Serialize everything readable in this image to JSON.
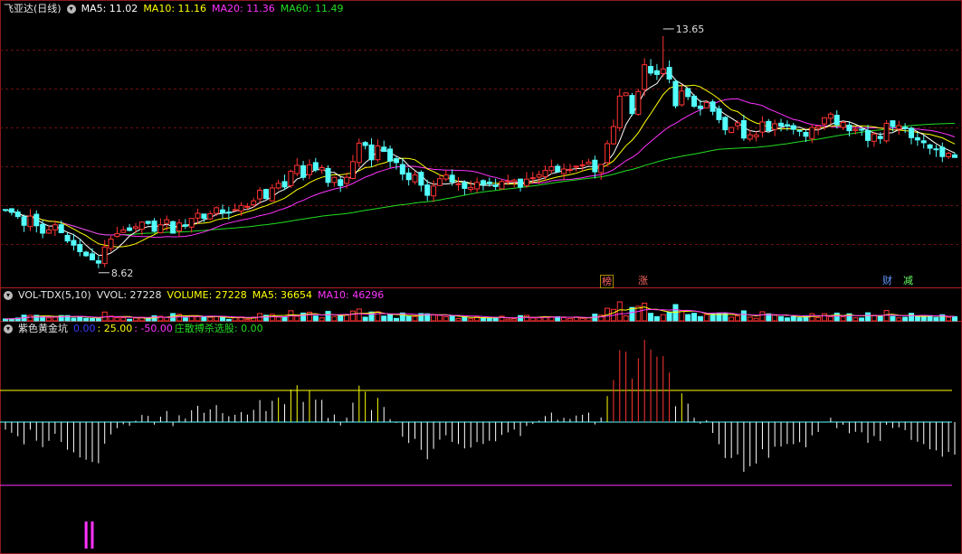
{
  "header_main": {
    "title": "飞亚达(日线)",
    "ma5_label": "MA5: 11.02",
    "ma10_label": "MA10: 11.16",
    "ma20_label": "MA20: 11.36",
    "ma60_label": "MA60: 11.49",
    "high_label": "13.65",
    "low_label": "8.62"
  },
  "header_vol": {
    "title": "VOL-TDX(5,10)",
    "vvol_label": "VVOL: 27228",
    "volume_label": "VOLUME: 27228",
    "ma5_label": "MA5: 36654",
    "ma10_label": "MA10: 46296"
  },
  "header_ind": {
    "title": "紫色黄金坑",
    "v1_label": "0.00",
    "v2_label": ": 25.00",
    "v3_label": ": -50.00",
    "v4_label": "庄散搏杀选股: 0.00"
  },
  "tags": [
    {
      "text": "榜"
    },
    {
      "text": "涨"
    },
    {
      "text": "财"
    },
    {
      "text": "减"
    }
  ],
  "colors": {
    "up": "#ff3333",
    "down": "#54ffff",
    "ma5": "#ffffff",
    "ma10": "#ffff00",
    "ma20": "#ff33ff",
    "ma60": "#22dd22",
    "grid": "#8b1a1a"
  },
  "chart_data": {
    "type": "candlestick",
    "ylim": [
      8.4,
      14.1
    ],
    "closes": [
      9.88,
      9.83,
      9.74,
      9.55,
      9.75,
      9.54,
      9.38,
      9.45,
      9.56,
      9.39,
      9.21,
      9.12,
      8.98,
      8.89,
      8.8,
      8.73,
      9.08,
      9.25,
      9.37,
      9.45,
      9.44,
      9.52,
      9.62,
      9.59,
      9.42,
      9.56,
      9.67,
      9.38,
      9.6,
      9.53,
      9.7,
      9.81,
      9.7,
      9.8,
      9.93,
      9.82,
      9.82,
      9.89,
      9.98,
      9.96,
      10.08,
      10.31,
      10.13,
      10.36,
      10.46,
      10.38,
      10.72,
      10.85,
      10.59,
      10.86,
      10.75,
      10.8,
      10.48,
      10.59,
      10.41,
      10.59,
      10.93,
      11.33,
      11.28,
      10.97,
      11.27,
      11.15,
      10.94,
      10.91,
      10.66,
      10.54,
      10.64,
      10.42,
      10.2,
      10.4,
      10.56,
      10.64,
      10.49,
      10.45,
      10.35,
      10.37,
      10.48,
      10.43,
      10.45,
      10.39,
      10.5,
      10.51,
      10.53,
      10.38,
      10.55,
      10.58,
      10.65,
      10.74,
      10.82,
      10.71,
      10.77,
      10.76,
      10.83,
      10.86,
      10.92,
      10.71,
      10.87,
      11.32,
      11.69,
      12.35,
      12.42,
      11.97,
      12.45,
      13.03,
      12.85,
      12.82,
      12.94,
      12.72,
      12.14,
      12.46,
      12.34,
      12.13,
      12.08,
      12.21,
      12.02,
      11.84,
      11.62,
      11.67,
      11.77,
      11.44,
      11.51,
      11.51,
      11.79,
      11.6,
      11.75,
      11.7,
      11.7,
      11.63,
      11.6,
      11.48,
      11.67,
      11.7,
      11.88,
      11.96,
      11.73,
      11.78,
      11.6,
      11.63,
      11.62,
      11.39,
      11.53,
      11.43,
      11.76,
      11.69,
      11.71,
      11.65,
      11.45,
      11.4,
      11.34,
      11.22,
      11.19,
      11.04,
      11.11,
      11.02
    ],
    "high": 13.65,
    "low": 8.62,
    "ma_last": {
      "MA5": 11.02,
      "MA10": 11.16,
      "MA20": 11.36,
      "MA60": 11.49
    },
    "volume": {
      "VVOL": 27228,
      "MA5": 36654,
      "MA10": 46296
    },
    "indicator": {
      "levels": [
        25,
        -50
      ],
      "last": 0.0
    }
  }
}
